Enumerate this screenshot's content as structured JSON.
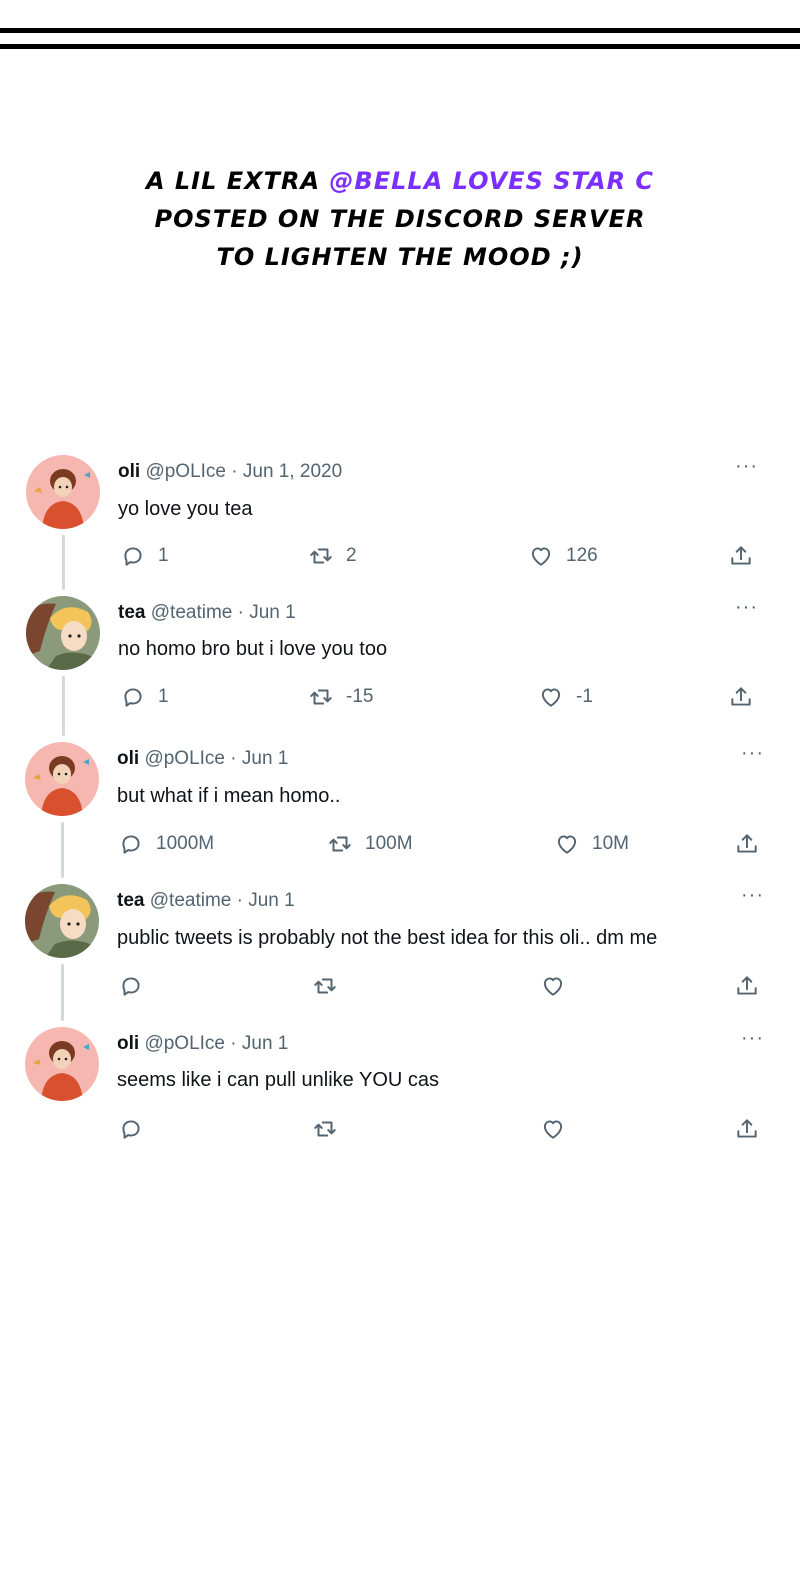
{
  "caption": {
    "line1_prefix": "A LIL EXTRA ",
    "line1_mention": "@BELLA LOVES STAR C",
    "line2": "POSTED ON THE DISCORD SERVER",
    "line3": "TO LIGHTEN THE MOOD ;)"
  },
  "colors": {
    "mention": "#7a2fff",
    "meta": "#536471",
    "thread_line": "#cfd9de"
  },
  "more_label": "···",
  "tweets": [
    {
      "name": "oli",
      "meta": "@pOLIce · Jun 1, 2020",
      "text": "yo love you tea",
      "reply": "1",
      "retweet": "2",
      "like": "126",
      "avatar": "oli"
    },
    {
      "name": "tea",
      "meta": "@teatime · Jun 1",
      "text": "no homo bro but i love you too",
      "reply": "1",
      "retweet": "-15",
      "like": "-1",
      "avatar": "tea"
    },
    {
      "name": "oli",
      "meta": "@pOLIce · Jun 1",
      "text": "but what if i mean homo..",
      "reply": "1000M",
      "retweet": "100M",
      "like": "10M",
      "avatar": "oli"
    },
    {
      "name": "tea",
      "meta": "@teatime · Jun 1",
      "text": "public tweets is probably not the best idea for this oli.. dm me",
      "reply": "",
      "retweet": "",
      "like": "",
      "avatar": "tea"
    },
    {
      "name": "oli",
      "meta": "@pOLIce · Jun 1",
      "text": "seems like i can pull unlike YOU cas",
      "reply": "",
      "retweet": "",
      "like": "",
      "avatar": "oli"
    }
  ],
  "icons": {
    "reply": "reply-icon",
    "retweet": "retweet-icon",
    "like": "heart-icon",
    "share": "share-icon",
    "more": "more-icon"
  }
}
